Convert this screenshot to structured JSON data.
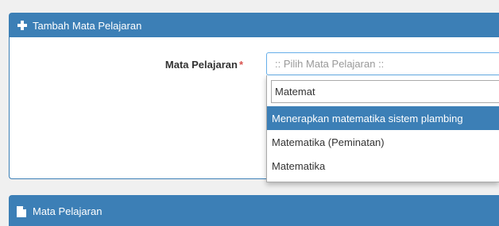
{
  "add_panel": {
    "title": "Tambah Mata Pelajaran",
    "icon": "plus-icon"
  },
  "form": {
    "label": "Mata Pelajaran",
    "required_mark": "*",
    "select_placeholder": ":: Pilih Mata Pelajaran ::",
    "search_value": "Matemat",
    "options": [
      "Menerapkan matematika sistem plambing",
      "Matematika (Peminatan)",
      "Matematika"
    ]
  },
  "list_panel": {
    "title": "Mata Pelajaran",
    "icon": "file-icon"
  },
  "colors": {
    "accent": "#3c7fb6",
    "required": "#d9534f"
  }
}
